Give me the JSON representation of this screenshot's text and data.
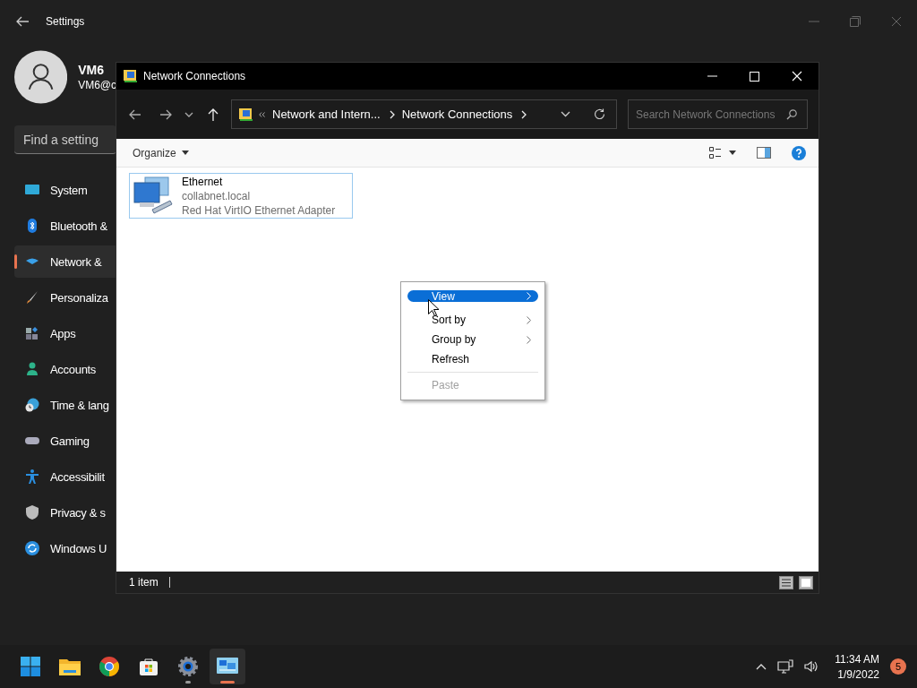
{
  "settings": {
    "title": "Settings",
    "user": {
      "name": "VM6",
      "email": "VM6@c"
    },
    "search": {
      "placeholder": "Find a setting"
    },
    "nav": [
      {
        "label": "System",
        "kind": "system",
        "selected": false
      },
      {
        "label": "Bluetooth &",
        "kind": "bluetooth",
        "selected": false
      },
      {
        "label": "Network &",
        "kind": "network",
        "selected": true
      },
      {
        "label": "Personaliza",
        "kind": "brush",
        "selected": false
      },
      {
        "label": "Apps",
        "kind": "apps",
        "selected": false
      },
      {
        "label": "Accounts",
        "kind": "accounts",
        "selected": false
      },
      {
        "label": "Time & lang",
        "kind": "time",
        "selected": false
      },
      {
        "label": "Gaming",
        "kind": "gaming",
        "selected": false
      },
      {
        "label": "Accessibilit",
        "kind": "accessibility",
        "selected": false
      },
      {
        "label": "Privacy & s",
        "kind": "privacy",
        "selected": false
      },
      {
        "label": "Windows U",
        "kind": "update",
        "selected": false
      }
    ]
  },
  "explorer": {
    "title": "Network Connections",
    "breadcrumb": [
      "Network and Intern...",
      "Network Connections"
    ],
    "search": {
      "placeholder": "Search Network Connections"
    },
    "organize": "Organize",
    "items": [
      {
        "name": "Ethernet",
        "domain": "collabnet.local",
        "adapter": "Red Hat VirtIO Ethernet Adapter",
        "focused": true
      }
    ],
    "status": "1 item"
  },
  "context_menu": {
    "items": [
      {
        "label": "View",
        "kind": "submenu",
        "selected": true,
        "disabled": false
      },
      {
        "label": "Sort by",
        "kind": "submenu",
        "selected": false,
        "disabled": false
      },
      {
        "label": "Group by",
        "kind": "submenu",
        "selected": false,
        "disabled": false
      },
      {
        "label": "Refresh",
        "kind": "command",
        "selected": false,
        "disabled": false
      },
      {
        "label": "Paste",
        "kind": "command",
        "selected": false,
        "disabled": true
      }
    ]
  },
  "taskbar": {
    "apps": [
      {
        "kind": "start",
        "running": false,
        "active": false
      },
      {
        "kind": "folder",
        "running": false,
        "active": false
      },
      {
        "kind": "browser",
        "running": false,
        "active": false
      },
      {
        "kind": "store",
        "running": false,
        "active": false
      },
      {
        "kind": "settings",
        "running": true,
        "active": false
      },
      {
        "kind": "network",
        "running": true,
        "active": true
      }
    ],
    "time": "11:34 AM",
    "date": "1/9/2022",
    "notifications": "5"
  }
}
